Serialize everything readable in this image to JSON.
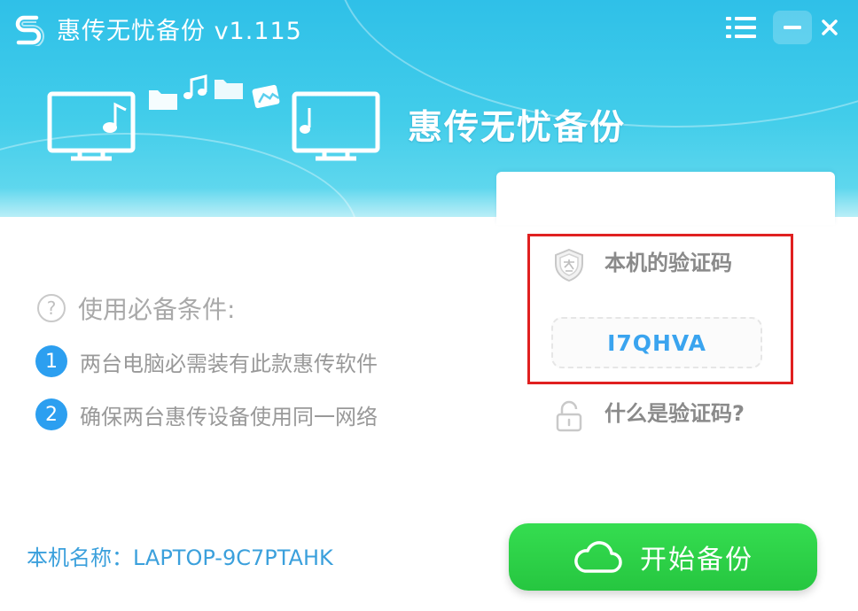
{
  "window": {
    "title": "惠传无忧备份 v1.115",
    "logo_icon": "s-logo-icon",
    "menu_icon": "menu-list-icon",
    "minimize_icon": "minimize-icon",
    "close_icon": "close-icon"
  },
  "banner": {
    "text": "惠传无忧备份",
    "illustration_icons": [
      "monitor-icon",
      "music-note-icon",
      "folder-icon",
      "image-icon",
      "monitor-icon"
    ]
  },
  "requirements": {
    "title": "使用必备条件:",
    "items": [
      {
        "num": "1",
        "text": "两台电脑必需装有此款惠传软件"
      },
      {
        "num": "2",
        "text": "确保两台惠传设备使用同一网络"
      }
    ]
  },
  "verify": {
    "label": "本机的验证码",
    "code": "I7QHVA",
    "help_link": "什么是验证码?"
  },
  "footer": {
    "machine_name": "本机名称：LAPTOP-9C7PTAHK",
    "start_button": "开始备份"
  },
  "colors": {
    "header_gradient": [
      "#2fc0e8",
      "#6adbef"
    ],
    "accent_blue": "#2c9ff0",
    "code_blue": "#3aa4ef",
    "start_green": "#2ccf45",
    "highlight_red": "#e02020"
  }
}
